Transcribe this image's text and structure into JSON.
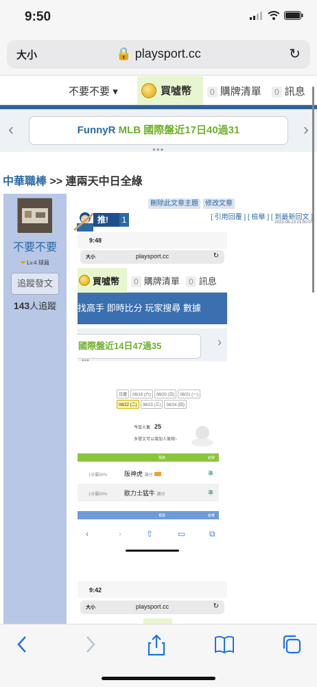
{
  "status": {
    "time": "9:50"
  },
  "browser": {
    "aa_label": "大小",
    "url": "playsport.cc",
    "reload_icon": "reload-icon"
  },
  "sitenav": {
    "dropdown_label": "不要不要",
    "coin_label": "買噓幣",
    "cart_count": "0",
    "cart_label": "購牌清單",
    "msg_count": "0",
    "msg_label": "訊息"
  },
  "marquee": {
    "prefix": "FunnyR ",
    "title": "MLB 國際盤近17日40過31",
    "prev": "‹",
    "next": "›"
  },
  "breadcrumb": {
    "category": "中華職棒",
    "sep": " >> ",
    "title": "連兩天中日全綠"
  },
  "user": {
    "name": "不要不要",
    "level": "Lv.4 球員",
    "follow_label": "追蹤發文",
    "follower_count": "143",
    "follower_suffix": "人追蹤"
  },
  "post": {
    "delete_label": "刪除此文章主題",
    "edit_label": "修改文章",
    "links": "[ 引用回覆 ]  [ 檢舉 ]  [ 到最新回文 ]",
    "time": "2023-08-23 21:50:07",
    "push_label": "推!",
    "push_count": "1"
  },
  "shot1": {
    "time": "9:48",
    "aa": "大小",
    "url": "playsport.cc",
    "coin": "買噓幣",
    "cart_count": "0",
    "cart": "購牌清單",
    "msg_count": "0",
    "msg": "訊息",
    "blue_nav": "找高手  即時比分  玩家搜尋  數據",
    "marquee": "國際盤近14日47過35",
    "dates": [
      "日曆",
      "08/19 (六)",
      "08/20 (日)",
      "08/21 (一)",
      "08/22 (二)",
      "08/23 (三)",
      "08/24 (四)"
    ],
    "selected_date": "08/22 (二)",
    "pop_label": "今日人氣",
    "pop_value": "25",
    "hint": "多發文可以增加人氣唷~",
    "col_pred": "預測",
    "col_result": "結果",
    "rows": [
      {
        "pct": "1分贏50%",
        "team": "阪神虎",
        "type": "讓分",
        "result": "準"
      },
      {
        "pct": "1分贏50%",
        "team": "歐力士猛牛",
        "type": "讓分",
        "result": "準"
      }
    ]
  },
  "shot2": {
    "time": "9:42",
    "aa": "大小",
    "url": "playsport.cc"
  }
}
